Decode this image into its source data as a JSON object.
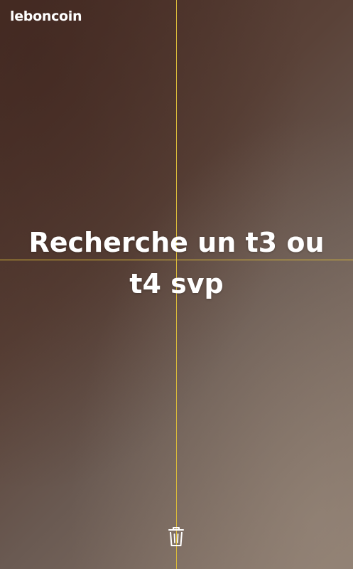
{
  "brand": {
    "logo_text": "leboncoin"
  },
  "story": {
    "caption": "Recherche un t3 ou t4 svp"
  },
  "toolbar": {
    "delete_icon": "trash-icon"
  },
  "colors": {
    "guide_line": "#d8b93a",
    "text": "#ffffff"
  }
}
